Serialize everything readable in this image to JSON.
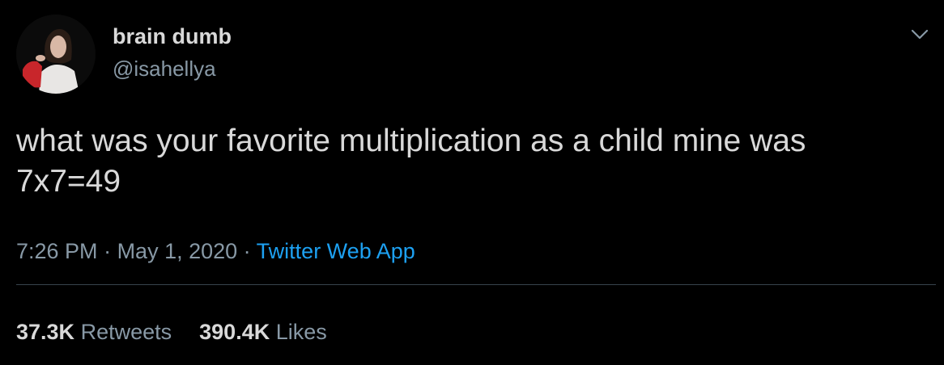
{
  "author": {
    "display_name": "brain dumb",
    "handle": "@isahellya",
    "avatar_icon": "profile-photo"
  },
  "tweet": {
    "text_line1": "what was your favorite multiplication as a child mine was",
    "text_line2": "7x7=49"
  },
  "meta": {
    "time": "7:26 PM",
    "separator1": " · ",
    "date": "May 1, 2020",
    "separator2": " · ",
    "source": "Twitter Web App"
  },
  "stats": {
    "retweets_count": "37.3K",
    "retweets_label": "Retweets",
    "likes_count": "390.4K",
    "likes_label": "Likes"
  },
  "menu_icon": "chevron-down-icon",
  "colors": {
    "background": "#000000",
    "primary_text": "#d9d9d9",
    "secondary_text": "#8899a6",
    "link": "#1da1f2",
    "divider": "#38444d"
  }
}
